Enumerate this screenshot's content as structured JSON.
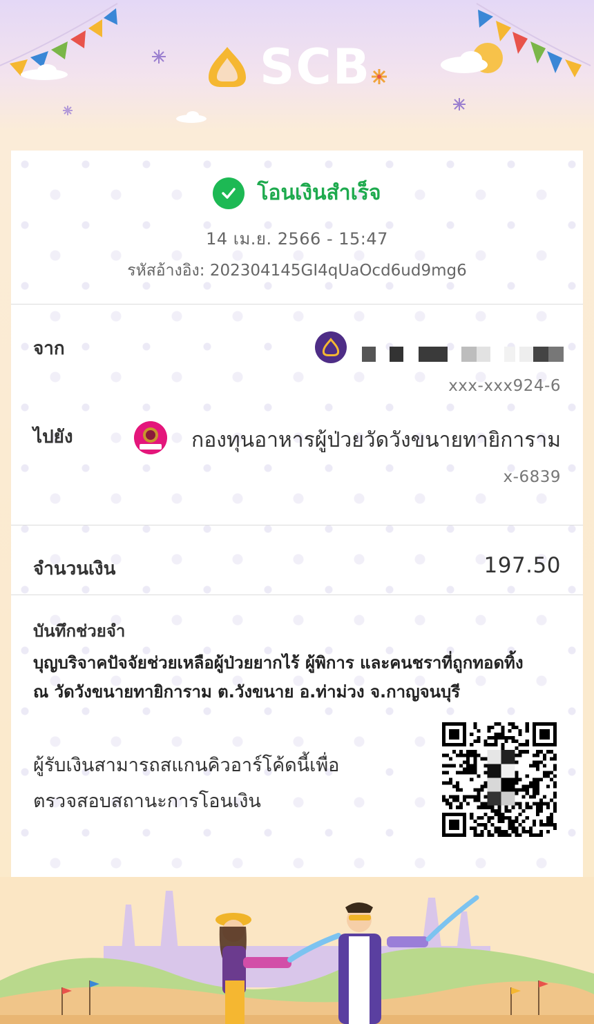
{
  "brand": {
    "logo_text": "SCB",
    "accent": "#4e2d86",
    "success": "#1db954"
  },
  "receipt": {
    "status": "โอนเงินสำเร็จ",
    "datetime": "14 เม.ย. 2566 - 15:47",
    "reference": "รหัสอ้างอิง: 202304145GI4qUaOcd6ud9mg6",
    "from": {
      "label": "จาก",
      "account": "xxx-xxx924-6"
    },
    "to": {
      "label": "ไปยัง",
      "name": "กองทุนอาหารผู้ป่วยวัดวังขนายทายิการาม",
      "account": "x-6839",
      "bank_badge": "ออมสิน"
    },
    "amount": {
      "label": "จำนวนเงิน",
      "value": "197.50"
    },
    "memo": {
      "label": "บันทึกช่วยจำ",
      "line1": "บุญบริจาคปัจจัยช่วยเหลือผู้ป่วยยากไร้ ผู้พิการ และคนชราที่ถูกทอดทิ้ง",
      "line2": "ณ วัดวังขนายทายิการาม ต.วังขนาย อ.ท่าม่วง จ.กาญจนบุรี"
    },
    "scan_note": {
      "line1": "ผู้รับเงินสามารถสแกนคิวอาร์โค้ดนี้เพื่อ",
      "line2": "ตรวจสอบสถานะการโอนเงิน"
    }
  },
  "icons": [
    "check-icon",
    "scb-logo-icon",
    "gsb-bank-icon",
    "qr-code"
  ]
}
